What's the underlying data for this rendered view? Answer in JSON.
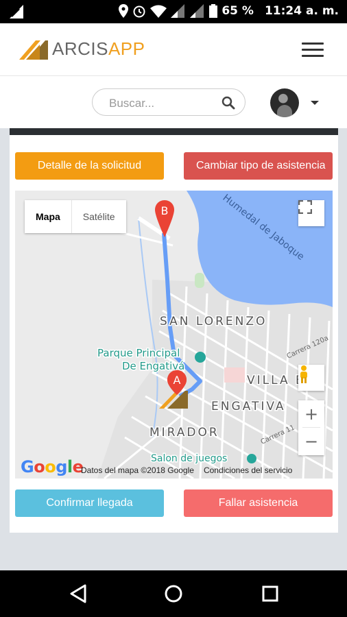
{
  "status_bar": {
    "battery": "65 %",
    "time": "11:24 a. m.",
    "icons": [
      "signal-icon",
      "location-icon",
      "alarm-icon",
      "wifi-icon",
      "cell-signal-icon",
      "cell-signal-2-icon",
      "battery-icon"
    ]
  },
  "app_bar": {
    "logo_part1": "ARCIS",
    "logo_part2": "APP",
    "menu_icon": "hamburger-icon"
  },
  "search": {
    "placeholder": "Buscar...",
    "icon": "search-icon"
  },
  "actions": {
    "detail_label": "Detalle de la solicitud",
    "change_type_label": "Cambiar tipo de asistencia",
    "confirm_label": "Confirmar llegada",
    "fail_label": "Fallar asistencia"
  },
  "map": {
    "type_map": "Mapa",
    "type_satellite": "Satélite",
    "zoom_in": "+",
    "zoom_out": "−",
    "google": "Google",
    "attribution_data": "Datos del mapa ©2018 Google",
    "attribution_terms": "Condiciones del servicio",
    "marker_a": "A",
    "marker_b": "B",
    "labels": {
      "humedal": "Humedal de Jaboque",
      "san_lorenzo": "SAN LORENZO",
      "parque_line1": "Parque Principal",
      "parque_line2": "De Engativá",
      "villa": "VILLA E",
      "engativa": "ENGATIVA",
      "mirador": "MIRADOR",
      "salon": "Salon de juegos",
      "carrera_120a": "Carrera 120a",
      "carrera_11": "Carrera 11"
    },
    "colors": {
      "water": "#8ab4f8",
      "route": "#669df6",
      "marker": "#ea4335",
      "poi": "#26a69a"
    }
  },
  "colors": {
    "orange": "#f39c12",
    "red": "#d9534f",
    "blue": "#5bc0de",
    "salmon": "#f56c6c",
    "brand": "#f0a020"
  }
}
